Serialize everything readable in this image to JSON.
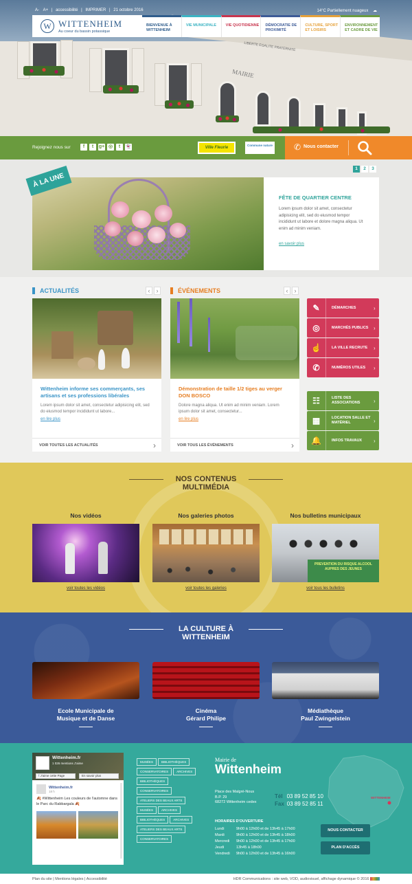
{
  "topbar": {
    "font_small": "A-",
    "font_large": "A+",
    "accessibility": "accessibilité",
    "print": "IMPRIMER",
    "date": "21 octobre 2016",
    "weather": "14°C Partiellement nuageux"
  },
  "logo": {
    "monogram": "W",
    "name": "WITTENHEIM",
    "tagline": "Au coeur du bassin potassique"
  },
  "nav": [
    {
      "label": "BIENVENUE À WITTENHEIM",
      "color": "#2f5d8c"
    },
    {
      "label": "VIE MUNICIPALE",
      "color": "#3bb3c3"
    },
    {
      "label": "VIE QUOTIDIENNE",
      "color": "#c8354e"
    },
    {
      "label": "DÉMOCRATIE DE PROXIMITÉ",
      "color": "#3c5a96"
    },
    {
      "label": "CULTURE, SPORT ET LOISIRS",
      "color": "#e5a13a"
    },
    {
      "label": "ENVIRONNEMENT ET CADRE DE VIE",
      "color": "#6a9b3e"
    }
  ],
  "hero": {
    "building_sign_1": "LIBERTE EGALITE FRATERNITE",
    "building_sign_2": "MAIRIE"
  },
  "social": {
    "join_label": "Rejoignez nous sur",
    "icons": [
      "f",
      "t",
      "g+",
      "◎",
      "t",
      "👻"
    ],
    "badge_1": "Ville Fleurie",
    "badge_2": "Commune nature",
    "contact_label": "Nous contacter"
  },
  "une": {
    "ribbon": "À LA UNE",
    "pages": [
      "1",
      "2",
      "3"
    ],
    "title": "FÊTE DE QUARTIER CENTRE",
    "text": "Lorem ipsum dolor sit amet, consectetur adipisicing elit, sed do eiusmod tempor incididunt ut labore et dolore magna aliqua. Ut enim ad minim veniam.",
    "more": "en savoir plus"
  },
  "actualites": {
    "title": "ACTUALITÉS",
    "card_title": "Wittenheim informe ses commerçants, ses artisans et ses professions libérales",
    "card_text": "Lorem ipsum dolor sit amet, consectetur adipisicing elit, sed do eiusmod tempor incididunt ut labore...",
    "more": "en lire plus",
    "footer": "VOIR TOUTES LES ACTUALITÉS"
  },
  "evenements": {
    "title": "ÉVÉNEMENTS",
    "card_title": "Démonstration de taille 1/2 tiges au verger DON BOSCO",
    "card_text": "Dolore magna aliqua. Ut enim ad minim veniam. Lorem ipsum dolor sit amet, consectetur...",
    "more": "en lire plus",
    "footer": "VOIR TOUS LES ÉVÉNEMENTS"
  },
  "quick_links": [
    {
      "label": "DÉMARCHES",
      "icon": "✎",
      "color": "#d23a5a"
    },
    {
      "label": "MARCHÉS PUBLICS",
      "icon": "◎",
      "color": "#d23a5a"
    },
    {
      "label": "LA VILLE RECRUTE",
      "icon": "☝",
      "color": "#d23a5a"
    },
    {
      "label": "NUMÉROS UTILES",
      "icon": "✆",
      "color": "#d23a5a"
    },
    {
      "label": "LISTE DES ASSOCIATIONS",
      "icon": "☷",
      "color": "#6a9b3e"
    },
    {
      "label": "LOCATION SALLE ET MATÉRIEL",
      "icon": "▦",
      "color": "#6a9b3e"
    },
    {
      "label": "INFOS TRAVAUX",
      "icon": "🔔",
      "color": "#6a9b3e"
    }
  ],
  "multimedia": {
    "title_1": "NOS CONTENUS",
    "title_2": "MULTIMÉDIA",
    "cols": [
      {
        "title": "Nos vidéos",
        "link": "voir toutes les vidéos"
      },
      {
        "title": "Nos galeries photos",
        "link": "voir toutes les galeries"
      },
      {
        "title": "Nos bulletins municipaux",
        "link": "voir tous les bulletins"
      }
    ],
    "banner_text": "PREVENTION DU RISQUE ALCOOL AUPRES DES JEUNES"
  },
  "culture": {
    "title_1": "LA CULTURE À",
    "title_2": "WITTENHEIM",
    "cols": [
      {
        "line1": "Ecole Municipale de",
        "line2": "Musique et de Danse"
      },
      {
        "line1": "Cinéma",
        "line2": "Gérard Philipe"
      },
      {
        "line1": "Médiathèque",
        "line2": "Paul Zwingelstein"
      }
    ]
  },
  "facebook": {
    "page_name": "Wittenheim.fr",
    "likes": "1 026 mentions J'aime",
    "like_btn": "J'aime cette Page",
    "share_btn": "En savoir plus",
    "post_author": "Wittenheim.fr",
    "post_time": "18 h",
    "post_text": "🍂 #Wittenheim Les couleurs de l'automne dans le Parc du Rabbargala 🍂"
  },
  "tags": [
    "MUSÉES",
    "BIBLIOTHÈQUES",
    "CONSERVATOIRES",
    "ARCHIVES",
    "BIBLIOTHÈQUES",
    "CONSERVATOIRES",
    "ATELIERS DES BEAUX ARTS",
    "MUSÉES",
    "ARCHIVES",
    "BIBLIOTHÈQUES",
    "ARCHIVES",
    "ATELIERS DES BEAUX ARTS",
    "CONSERVATOIRES"
  ],
  "mairie": {
    "small": "Mairie de",
    "name": "Wittenheim",
    "address_1": "Place des Malgré-Nous",
    "address_2": "B.P. 29",
    "address_3": "68272 Wittenheim cedex",
    "tel_label": "Tél",
    "tel": "03 89 52 85 10",
    "fax_label": "Fax",
    "fax": "03 89 52 85 11",
    "hours_title": "HORAIRES D'OUVERTURE",
    "hours": [
      {
        "day": "Lundi",
        "time": "9h00 à 12h00 et de 13h45 à 17h00"
      },
      {
        "day": "Mardi",
        "time": "9h00 à 12h00 et de 13h45 à 18h00"
      },
      {
        "day": "Mercredi",
        "time": "9h00 à 12h00 et de 13h45 à 17h00"
      },
      {
        "day": "Jeudi",
        "time": "13h45 à 18h00"
      },
      {
        "day": "Vendredi",
        "time": "9h00 à 12h00 et de 13h45 à 16h00"
      }
    ],
    "btn_contact": "NOUS CONTACTER",
    "btn_plan": "PLAN D'ACCÈS",
    "map_label": "WITTENHEIM"
  },
  "bottom": {
    "links": [
      "Plan du site",
      "Mentions légales",
      "Accessibilité"
    ],
    "credits": "HDR Communications : site web, VOD, audiovisuel, affichage dynamique © 2016"
  }
}
